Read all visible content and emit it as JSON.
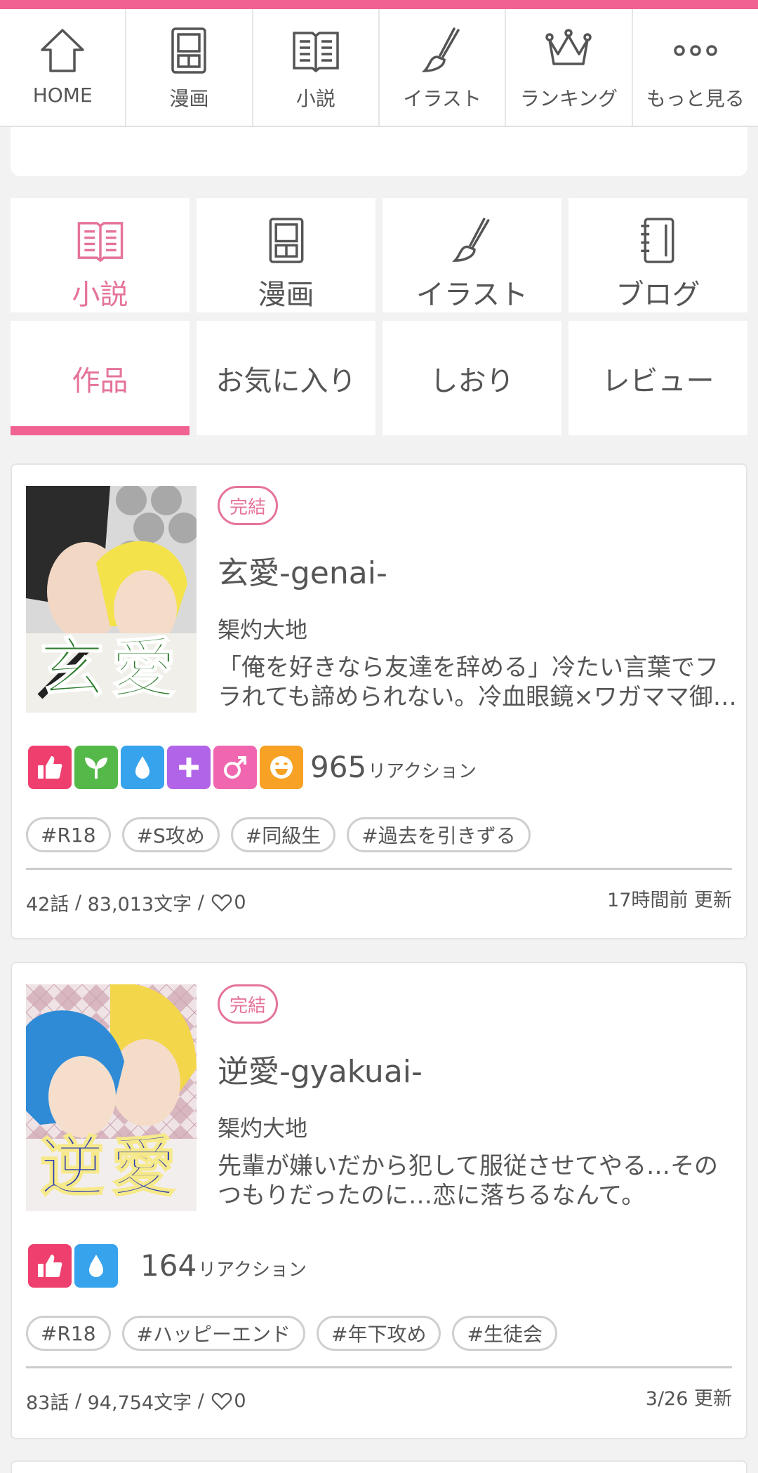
{
  "topnav": [
    {
      "label": "HOME",
      "icon": "home-icon"
    },
    {
      "label": "漫画",
      "icon": "manga-icon"
    },
    {
      "label": "小説",
      "icon": "novel-icon"
    },
    {
      "label": "イラスト",
      "icon": "brush-icon"
    },
    {
      "label": "ランキング",
      "icon": "crown-icon"
    },
    {
      "label": "もっと見る",
      "icon": "more-icon"
    }
  ],
  "categories": [
    {
      "label": "小説",
      "icon": "novel-icon",
      "active": true
    },
    {
      "label": "漫画",
      "icon": "manga-icon",
      "active": false
    },
    {
      "label": "イラスト",
      "icon": "brush-icon",
      "active": false
    },
    {
      "label": "ブログ",
      "icon": "notebook-icon",
      "active": false
    }
  ],
  "subtabs": [
    {
      "label": "作品",
      "active": true
    },
    {
      "label": "お気に入り",
      "active": false
    },
    {
      "label": "しおり",
      "active": false
    },
    {
      "label": "レビュー",
      "active": false
    }
  ],
  "colors": {
    "accent": "#f06292",
    "accent_text": "#e5739b"
  },
  "works": [
    {
      "status": "完結",
      "title": "玄愛-genai-",
      "author": "榘灼大地",
      "synopsis": "「俺を好きなら友達を辞める」冷たい言葉でフラれても諦められない。冷血眼鏡×ワガママ御…",
      "cover_text": "玄愛",
      "reactions": [
        "thumbs-up",
        "sprout",
        "drop",
        "plus",
        "male",
        "smile"
      ],
      "reaction_count": "965",
      "reaction_unit": "リアクション",
      "tags": [
        "#R18",
        "#S攻め",
        "#同級生",
        "#過去を引きずる"
      ],
      "episodes": "42話",
      "chars": "83,013文字",
      "likes": "0",
      "updated": "17時間前 更新"
    },
    {
      "status": "完結",
      "title": "逆愛-gyakuai-",
      "author": "榘灼大地",
      "synopsis": "先輩が嫌いだから犯して服従させてやる…そのつもりだったのに…恋に落ちるなんて。",
      "cover_text": "逆愛",
      "reactions": [
        "thumbs-up",
        "drop"
      ],
      "reaction_count": "164",
      "reaction_unit": "リアクション",
      "tags": [
        "#R18",
        "#ハッピーエンド",
        "#年下攻め",
        "#生徒会"
      ],
      "episodes": "83話",
      "chars": "94,754文字",
      "likes": "0",
      "updated": "3/26 更新"
    }
  ]
}
